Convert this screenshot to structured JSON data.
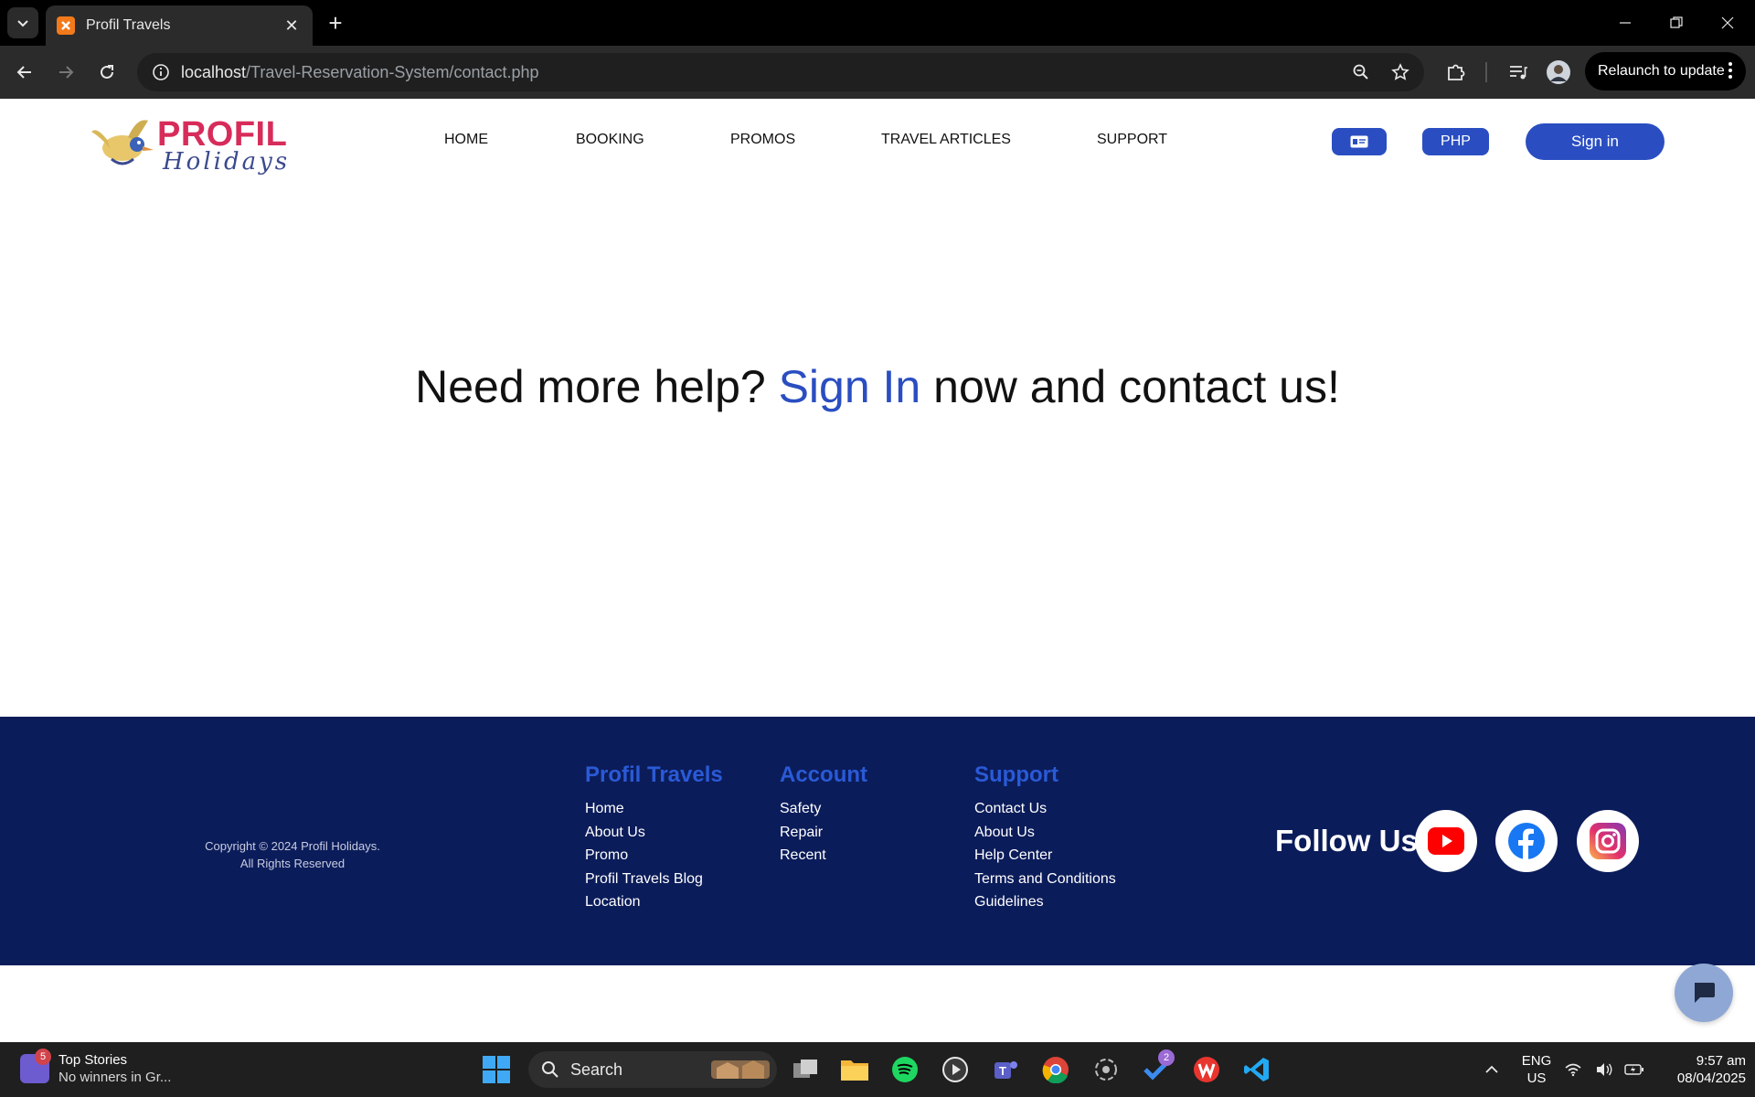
{
  "browser": {
    "tab_title": "Profil Travels",
    "url_host": "localhost",
    "url_path": "/Travel-Reservation-System/contact.php",
    "relaunch_label": "Relaunch to update"
  },
  "site": {
    "logo_text": "PROFIL",
    "logo_script": "Holidays",
    "nav": [
      "HOME",
      "BOOKING",
      "PROMOS",
      "TRAVEL ARTICLES",
      "SUPPORT"
    ],
    "currency_label": "PHP",
    "signin_label": "Sign in",
    "accent_color": "#2a4ec1"
  },
  "hero": {
    "before": "Need more help? ",
    "link": "Sign In",
    "after": " now and contact us!"
  },
  "footer": {
    "copyright_line1": "Copyright © 2024 Profil Holidays.",
    "copyright_line2": "All Rights Reserved",
    "columns": [
      {
        "title": "Profil Travels",
        "links": [
          "Home",
          "About Us",
          "Promo",
          "Profil Travels Blog",
          "Location"
        ]
      },
      {
        "title": "Account",
        "links": [
          "Safety",
          "Repair",
          "Recent"
        ]
      },
      {
        "title": "Support",
        "links": [
          "Contact Us",
          "About Us",
          "Help Center",
          "Terms and Conditions",
          "Guidelines"
        ]
      }
    ],
    "follow_label": "Follow Us",
    "social_icons": [
      "youtube-icon",
      "facebook-icon",
      "instagram-icon"
    ],
    "background_color": "#0b1c5a"
  },
  "taskbar": {
    "news_badge": "5",
    "news_title": "Top Stories",
    "news_sub": "No winners in Gr...",
    "search_label": "Search",
    "todo_badge": "2",
    "lang_line1": "ENG",
    "lang_line2": "US",
    "time": "9:57 am",
    "date": "08/04/2025"
  }
}
